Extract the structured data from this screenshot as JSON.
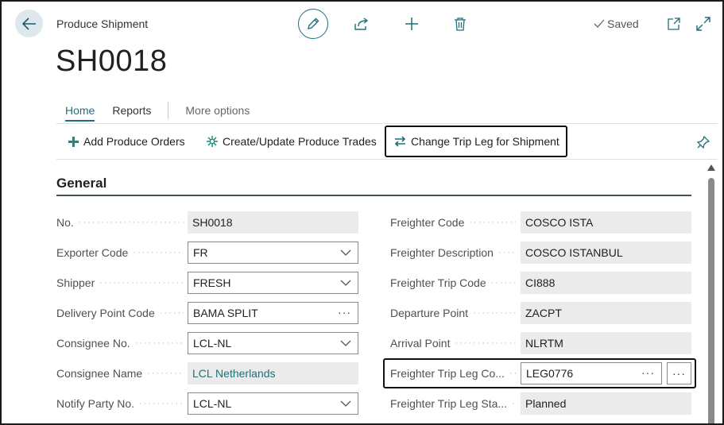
{
  "header": {
    "caption": "Produce Shipment",
    "title": "SH0018",
    "status": "Saved"
  },
  "tabs": {
    "home": "Home",
    "reports": "Reports",
    "more": "More options"
  },
  "actions": {
    "add_orders": "Add Produce Orders",
    "create_trades": "Create/Update Produce Trades",
    "change_trip_leg": "Change Trip Leg for Shipment"
  },
  "section": {
    "title": "General"
  },
  "left_fields": {
    "no": {
      "label": "No.",
      "value": "SH0018"
    },
    "exporter_code": {
      "label": "Exporter Code",
      "value": "FR"
    },
    "shipper": {
      "label": "Shipper",
      "value": "FRESH"
    },
    "delivery_point": {
      "label": "Delivery Point Code",
      "value": "BAMA SPLIT"
    },
    "consignee_no": {
      "label": "Consignee No.",
      "value": "LCL-NL"
    },
    "consignee_name": {
      "label": "Consignee Name",
      "value": "LCL Netherlands"
    },
    "notify_party": {
      "label": "Notify Party No.",
      "value": "LCL-NL"
    }
  },
  "right_fields": {
    "freighter_code": {
      "label": "Freighter Code",
      "value": "COSCO ISTA"
    },
    "freighter_desc": {
      "label": "Freighter Description",
      "value": "COSCO ISTANBUL"
    },
    "trip_code": {
      "label": "Freighter Trip Code",
      "value": "CI888"
    },
    "departure": {
      "label": "Departure Point",
      "value": "ZACPT"
    },
    "arrival": {
      "label": "Arrival Point",
      "value": "NLRTM"
    },
    "trip_leg_code": {
      "label": "Freighter Trip Leg Co...",
      "value": "LEG0776"
    },
    "trip_leg_status": {
      "label": "Freighter Trip Leg Sta...",
      "value": "Planned"
    }
  },
  "icons": {
    "back": "back-arrow-icon",
    "edit": "pencil-icon",
    "share": "share-icon",
    "new": "plus-icon",
    "delete": "trash-icon",
    "saved_check": "check-icon",
    "open_window": "open-in-new-window-icon",
    "expand": "expand-icon",
    "add": "plus-icon",
    "create": "sparkle-icon",
    "change": "swap-arrows-icon",
    "pin": "pin-icon"
  },
  "colors": {
    "accent": "#1f6f7a",
    "add_icon": "#1f8a7a",
    "readonly_bg": "#ebebeb"
  }
}
